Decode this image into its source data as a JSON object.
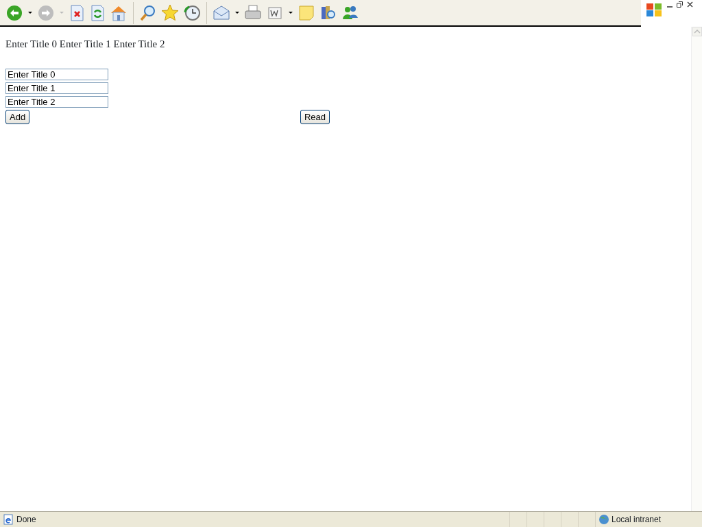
{
  "page": {
    "text": "Enter Title 0 Enter Title 1 Enter Title 2",
    "fields": [
      {
        "value": "Enter Title 0"
      },
      {
        "value": "Enter Title 1"
      },
      {
        "value": "Enter Title 2"
      }
    ],
    "buttons": [
      "Add",
      "Read"
    ]
  },
  "status_bar": {
    "text": "Done",
    "zone": "Local intranet"
  }
}
